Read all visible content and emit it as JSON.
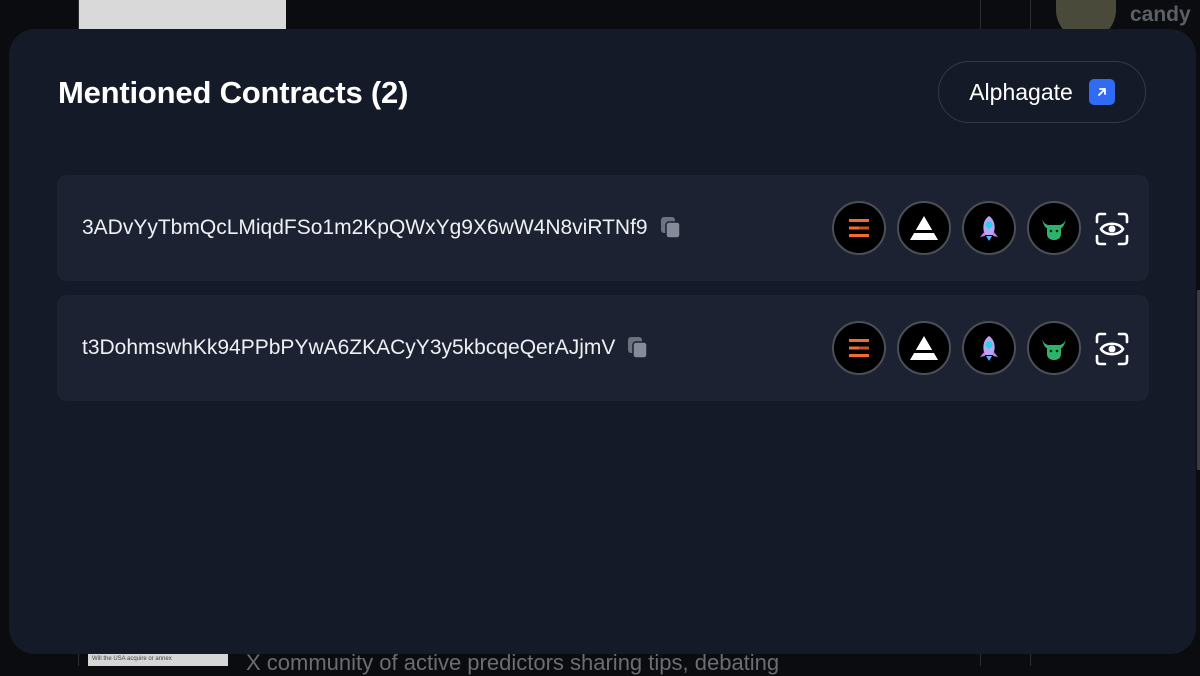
{
  "background": {
    "user_name": "candy",
    "bottom_caption": "X community of active predictors sharing tips, debating",
    "thumb_caption": "Will the USA acquire or annex"
  },
  "modal": {
    "title": "Mentioned Contracts (2)",
    "external_button_label": "Alphagate",
    "contracts": [
      {
        "address": "3ADvYyTbmQcLMiqdFSo1m2KpQWxYg9X6wW4N8viRTNf9"
      },
      {
        "address": "t3DohmswhKk94PPbPYwA6ZKACyY3y5kbcqeQerAJjmV"
      }
    ]
  },
  "colors": {
    "modal_bg": "#141a27",
    "row_bg": "#1c2231",
    "accent_blue": "#2f6bf5",
    "orange_tool": "#f26c2a",
    "green_tool": "#2fb36a"
  },
  "icons": [
    "external-link-icon",
    "copy-icon",
    "orange-bars-icon",
    "white-triangle-icon",
    "rocket-icon",
    "bull-icon",
    "eye-scan-icon"
  ]
}
